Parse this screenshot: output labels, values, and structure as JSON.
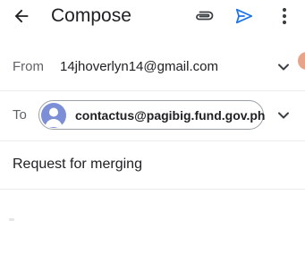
{
  "app_bar": {
    "title": "Compose",
    "back_icon": "arrow-back-icon",
    "attach_icon": "paperclip-icon",
    "send_icon": "send-icon",
    "more_icon": "more-vert-icon"
  },
  "from": {
    "label": "From",
    "value": "14jhoverlyn14@gmail.com"
  },
  "to": {
    "label": "To",
    "recipient": "contactus@pagibig.fund.gov.ph"
  },
  "subject": {
    "value": "Request for merging"
  },
  "colors": {
    "send_accent": "#1a73e8",
    "avatar_bg": "#7b8ed6",
    "edge_dot": "#e8a48a"
  }
}
